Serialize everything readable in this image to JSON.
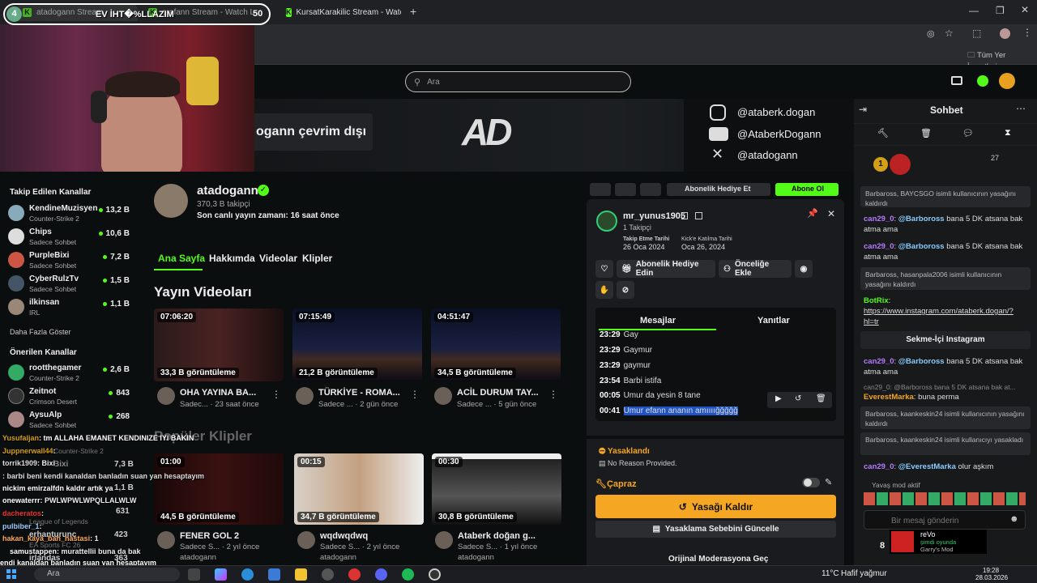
{
  "browser": {
    "tabs": [
      {
        "label": "atadogann Stream"
      },
      {
        "label": "erafann Stream - Watch L"
      },
      {
        "label": "KursatKarakilic Stream - Watch"
      }
    ],
    "overlay_badge": "4",
    "overlay_title": "EV İHT�%LLAZIM",
    "overlay_count": "50",
    "bookmarks_label": "Tüm Yer İşaretleri"
  },
  "header": {
    "search_placeholder": "Ara"
  },
  "banner": {
    "offline_text": "ogann çevrim dışı",
    "logo_text": "AD",
    "socials": [
      "@ataberk.dogan",
      "@AtaberkDogann",
      "@atadogann"
    ]
  },
  "sidebar": {
    "followed_title": "Takip Edilen Kanallar",
    "followed": [
      {
        "name": "KendineMuzisyen",
        "sub": "Counter-Strike 2",
        "viewers": "13,2 B"
      },
      {
        "name": "Chips",
        "sub": "Sadece Sohbet",
        "viewers": "10,6 B"
      },
      {
        "name": "PurpleBixi",
        "sub": "Sadece Sohbet",
        "viewers": "7,2 B"
      },
      {
        "name": "CyberRulzTv",
        "sub": "Sadece Sohbet",
        "viewers": "1,5 B"
      },
      {
        "name": "ilkinsan",
        "sub": "IRL",
        "viewers": "1,1 B"
      }
    ],
    "more": "Daha Fazla Göster",
    "recommended_title": "Önerilen Kanallar",
    "recommended": [
      {
        "name": "rootthegamer",
        "sub": "Counter-Strike 2",
        "viewers": "2,6 B"
      },
      {
        "name": "Zeitnot",
        "sub": "Crimson Desert",
        "viewers": "843"
      },
      {
        "name": "AysuAlp",
        "sub": "Sadece Sohbet",
        "viewers": "268"
      }
    ],
    "hidden_viewers": [
      "7,3 B",
      "1,1 B",
      "631",
      "423",
      "363"
    ],
    "hidden_names": [
      "Bixi",
      "erhanturunc",
      "irlandas"
    ],
    "hidden_games": [
      "League of Legends",
      "EA Sports FC 26",
      "Counter-Strike 2"
    ]
  },
  "channel": {
    "name": "atadogann",
    "followers": "370,3 B takipçi",
    "last_live": "Son canlı yayın zamanı: 16 saat önce",
    "tabs": [
      "Ana Sayfa",
      "Hakkımda",
      "Videolar",
      "Klipler"
    ],
    "videos_title": "Yayın Videoları",
    "videos": [
      {
        "duration": "07:06:20",
        "views": "33,3 B görüntüleme",
        "title": "OHA YAYINA BA...",
        "sub": "Sadec...",
        "age": "23 saat önce"
      },
      {
        "duration": "07:15:49",
        "views": "21,2 B görüntüleme",
        "title": "TÜRKİYE - ROMA...",
        "sub": "Sadece ...",
        "age": "2 gün önce"
      },
      {
        "duration": "04:51:47",
        "views": "34,5 B görüntüleme",
        "title": "ACİL DURUM TAY...",
        "sub": "Sadece ...",
        "age": "5 gün önce"
      }
    ],
    "clips_title": "Popüler Klipler",
    "clips": [
      {
        "duration": "01:00",
        "views": "44,5 B görüntüleme",
        "title": "FENER GOL 2",
        "sub": "Sadece S...",
        "age": "2 yıl önce",
        "author": "atadogann"
      },
      {
        "duration": "00:15",
        "views": "34,7 B görüntüleme",
        "title": "wqdwqdwq",
        "sub": "Sadece S...",
        "age": "2 yıl önce",
        "author": "atadogann"
      },
      {
        "duration": "00:30",
        "views": "30,8 B görüntüleme",
        "title": "Ataberk doğan g...",
        "sub": "Sadece S...",
        "age": "1 yıl önce",
        "author": "atadogann"
      }
    ]
  },
  "toolbar_behind": {
    "subscribe_gift": "Abonelik Hediye Et",
    "follow": "Abone Ol"
  },
  "popup": {
    "username": "mr_yunus1905",
    "followers": "1 Takipçi",
    "follow_date_label": "Takip Etme Tarihi",
    "follow_date": "26 Oca 2024",
    "join_date_label": "Kick'e Katılma Tarihi",
    "join_date": "Oca 26, 2024",
    "gift_button": "Abonelik Hediye Edin",
    "priority_button": "Önceliğe Ekle",
    "tab_messages": "Mesajlar",
    "tab_replies": "Yanıtlar",
    "messages": [
      {
        "time": "23:29",
        "text": "Gay"
      },
      {
        "time": "23:29",
        "text": "Gaymur"
      },
      {
        "time": "23:29",
        "text": "gaymur"
      },
      {
        "time": "23:54",
        "text": "Barbi istifa"
      },
      {
        "time": "00:05",
        "text": "Umur da yesin 8 tane"
      },
      {
        "time": "00:41",
        "text": "Umur efann ananın amıııığğğğğ"
      }
    ],
    "banned_label": "Yasaklandı",
    "reason": "No Reason Provided.",
    "cross_label": "Çapraz",
    "unban_button": "Yasağı Kaldır",
    "update_reason_button": "Yasaklama Sebebini Güncelle",
    "original_mod": "Orijinal Moderasyona Geç",
    "accent": "#f5a623"
  },
  "chat": {
    "title": "Sohbet",
    "pinned_count": "27",
    "messages": [
      {
        "type": "sys",
        "text": "Barbaross, BAYCSGO isimli kullanıcının yasağını kaldırdı"
      },
      {
        "type": "msg",
        "user": "can29_0",
        "mention": "@Barboross",
        "text": "bana 5 DK atsana bak atma ama"
      },
      {
        "type": "msg",
        "user": "can29_0",
        "mention": "@Barboross",
        "text": "bana 5 DK atsana bak atma ama"
      },
      {
        "type": "sys",
        "text": "Barbaross, hasanpala2006 isimli kullanıcının yasağını kaldırdı"
      },
      {
        "type": "bot",
        "user": "BotRix",
        "text": "https://www.instagram.com/ataberk.dogan/?hl=tr"
      },
      {
        "type": "btn",
        "text": "Sekme-İçi Instagram"
      },
      {
        "type": "msg",
        "user": "can29_0",
        "mention": "@Barboross",
        "text": "bana 5 DK atsana bak atma ama"
      },
      {
        "type": "reply",
        "text": "can29_0: @Barboross bana 5 DK atsana bak at..."
      },
      {
        "type": "msg2",
        "user": "EverestMarka",
        "text": "buna perma"
      },
      {
        "type": "sys",
        "text": "Barbaross, kaankeskin24 isimli kullanıcının yasağını kaldırdı"
      },
      {
        "type": "sys",
        "text": "Barbaross, kaankeskin24 isimli kullanıcıyı yasakladı"
      },
      {
        "type": "msg",
        "user": "can29_0",
        "mention": "@EverestMarka",
        "text": "olur aşkım"
      }
    ],
    "slow_mode": "Yavaş mod aktif",
    "input_placeholder": "Bir mesaj gönderin",
    "points": "8",
    "now_playing_user": "reVo",
    "now_playing_status": "şimdi oyunda",
    "now_playing_game": "Garry's Mod"
  },
  "overlay_chat": [
    {
      "user": "Yusufaljan",
      "text": ": tm ALLAHA EMANET KENDINIZE IYI BAKIN",
      "color": "#d4a017"
    },
    {
      "user": "Juppnerwall44",
      "text": ":",
      "color": "#d4a017"
    },
    {
      "user": "torrik1909",
      "text": ": Bixi",
      "color": "#ddd"
    },
    {
      "user": "",
      "text": ": barbi beni kendi kanaldan banladın suan yan hesaptayım",
      "color": "#ddd"
    },
    {
      "user": "",
      "text": "nickim emirzalfdn kaldır artık ya",
      "color": "#fff"
    },
    {
      "user": "onewaterrr",
      "text": ": PWLWPWLWPQLLALWLW",
      "color": "#fff"
    },
    {
      "user": "dacheratos",
      "text": ":",
      "color": "#e33"
    },
    {
      "user": "pulbiber_1",
      "text": ":",
      "color": "#9cf"
    },
    {
      "user": "hakan_kaya_ban_hastasi",
      "text": ": 1",
      "color": "#fa5"
    },
    {
      "user": "samustappen",
      "text": ": murattellii buna da bak",
      "color": "#fff"
    },
    {
      "user": "",
      "text": "endi kanaldan banladın suan yan hesaptayım",
      "color": "#fff"
    }
  ],
  "taskbar": {
    "search": "Ara",
    "weather": "11°C",
    "weather_desc": "Hafif yağmur",
    "time": "19:28",
    "date": "28.03.2026"
  }
}
